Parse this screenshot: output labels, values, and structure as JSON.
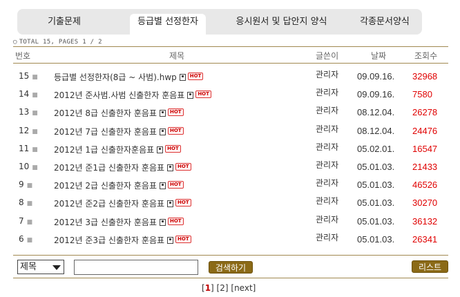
{
  "tabs": [
    {
      "label": "기출문제"
    },
    {
      "label": "등급별 선정한자"
    },
    {
      "label": "응시원서 및 답안지 양식"
    },
    {
      "label": "각종문서양식"
    }
  ],
  "summary": "TOTAL 15,  PAGES 1 / 2",
  "columns": {
    "num": "번호",
    "title": "제목",
    "author": "글쓴이",
    "date": "날짜",
    "views": "조회수"
  },
  "rows": [
    {
      "num": "15",
      "title": "등급별 선정한자(8급 ~ 사범).hwp",
      "author": "관리자",
      "date": "09.09.16.",
      "views": "32968"
    },
    {
      "num": "14",
      "title": "2012년 준사범.사범 신출한자 훈음표",
      "author": "관리자",
      "date": "09.09.16.",
      "views": "7580"
    },
    {
      "num": "13",
      "title": "2012년 8급 신출한자 훈음표",
      "author": "관리자",
      "date": "08.12.04.",
      "views": "26278"
    },
    {
      "num": "12",
      "title": "2012년 7급 신출한자 훈음표",
      "author": "관리자",
      "date": "08.12.04.",
      "views": "24476"
    },
    {
      "num": "11",
      "title": "2012년 1급 신출한자훈음표",
      "author": "관리자",
      "date": "05.02.01.",
      "views": "16547"
    },
    {
      "num": "10",
      "title": "2012년 준1급 신출한자 훈음표",
      "author": "관리자",
      "date": "05.01.03.",
      "views": "21433"
    },
    {
      "num": "9",
      "title": "2012년 2급 신출한자 훈음표",
      "author": "관리자",
      "date": "05.01.03.",
      "views": "46526"
    },
    {
      "num": "8",
      "title": "2012년 준2급 신출한자 훈음표",
      "author": "관리자",
      "date": "05.01.03.",
      "views": "30270"
    },
    {
      "num": "7",
      "title": "2012년 3급 신출한자 훈음표",
      "author": "관리자",
      "date": "05.01.03.",
      "views": "36132"
    },
    {
      "num": "6",
      "title": "2012년 준3급 신출한자 훈음표",
      "author": "관리자",
      "date": "05.01.03.",
      "views": "26341"
    }
  ],
  "hot_label": "HOT",
  "search": {
    "field_selected": "제목",
    "button_label": "검색하기"
  },
  "list_button_label": "리스트",
  "pager": {
    "current": "1",
    "page2": "2",
    "next": "next"
  },
  "colors": {
    "accent": "#8b6a17",
    "views_red": "#e00000",
    "rule": "#a08850"
  }
}
